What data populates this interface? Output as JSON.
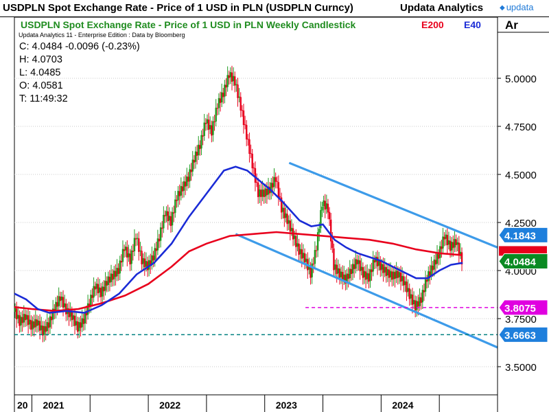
{
  "header": {
    "title": "USDPLN Spot Exchange Rate - Price of 1 USD in PLN (USDPLN Curncy)",
    "brand": "Updata Analytics",
    "logo_text": "updata",
    "logo_icon": "updata-logo-icon",
    "corner_label": "Ar"
  },
  "chart_data": {
    "type": "candlestick",
    "title": "USDPLN Spot Exchange Rate - Price of 1 USD in PLN Weekly Candlestick",
    "indicators": [
      {
        "name": "E200",
        "color": "#e8001c"
      },
      {
        "name": "E40",
        "color": "#1a2bd6"
      }
    ],
    "source_note": "Updata Analytics 11 - Enterprise Edition : Data by Bloomberg",
    "readout": {
      "close": "C: 4.0484  -0.0096 (-0.23%)",
      "high": "H: 4.0703",
      "low": "L: 4.0485",
      "open": "O: 4.0581",
      "time": "T: 11:49:32"
    },
    "x_axis_labels": [
      "20",
      "2021",
      "2022",
      "2023",
      "2024"
    ],
    "y_ticks": [
      "5.0000",
      "4.7500",
      "4.5000",
      "4.2500",
      "4.0000",
      "3.7500",
      "3.5000"
    ],
    "y_tick_values": [
      5.0,
      4.75,
      4.5,
      4.25,
      4.0,
      3.75,
      3.5
    ],
    "ylim": [
      3.42,
      5.17
    ],
    "x_range": [
      2020.85,
      2025.0
    ],
    "close_series": [
      [
        2020.85,
        3.8
      ],
      [
        2020.9,
        3.73
      ],
      [
        2020.95,
        3.76
      ],
      [
        2021.0,
        3.71
      ],
      [
        2021.05,
        3.73
      ],
      [
        2021.1,
        3.68
      ],
      [
        2021.15,
        3.72
      ],
      [
        2021.2,
        3.8
      ],
      [
        2021.25,
        3.86
      ],
      [
        2021.3,
        3.79
      ],
      [
        2021.35,
        3.76
      ],
      [
        2021.4,
        3.7
      ],
      [
        2021.45,
        3.74
      ],
      [
        2021.5,
        3.83
      ],
      [
        2021.55,
        3.92
      ],
      [
        2021.6,
        3.88
      ],
      [
        2021.65,
        3.94
      ],
      [
        2021.7,
        3.97
      ],
      [
        2021.75,
        4.0
      ],
      [
        2021.8,
        4.12
      ],
      [
        2021.85,
        4.05
      ],
      [
        2021.9,
        4.18
      ],
      [
        2021.95,
        4.05
      ],
      [
        2022.0,
        4.02
      ],
      [
        2022.05,
        4.07
      ],
      [
        2022.1,
        4.17
      ],
      [
        2022.15,
        4.3
      ],
      [
        2022.2,
        4.25
      ],
      [
        2022.25,
        4.38
      ],
      [
        2022.3,
        4.43
      ],
      [
        2022.35,
        4.48
      ],
      [
        2022.4,
        4.58
      ],
      [
        2022.45,
        4.65
      ],
      [
        2022.5,
        4.78
      ],
      [
        2022.55,
        4.72
      ],
      [
        2022.6,
        4.86
      ],
      [
        2022.65,
        4.92
      ],
      [
        2022.7,
        5.02
      ],
      [
        2022.75,
        4.98
      ],
      [
        2022.8,
        4.85
      ],
      [
        2022.85,
        4.7
      ],
      [
        2022.9,
        4.55
      ],
      [
        2022.95,
        4.4
      ],
      [
        2023.0,
        4.4
      ],
      [
        2023.05,
        4.42
      ],
      [
        2023.1,
        4.48
      ],
      [
        2023.15,
        4.32
      ],
      [
        2023.2,
        4.26
      ],
      [
        2023.25,
        4.18
      ],
      [
        2023.3,
        4.1
      ],
      [
        2023.35,
        4.06
      ],
      [
        2023.4,
        3.98
      ],
      [
        2023.45,
        4.12
      ],
      [
        2023.5,
        4.35
      ],
      [
        2023.55,
        4.32
      ],
      [
        2023.6,
        4.02
      ],
      [
        2023.65,
        3.98
      ],
      [
        2023.7,
        3.95
      ],
      [
        2023.75,
        4.0
      ],
      [
        2023.8,
        4.05
      ],
      [
        2023.85,
        3.98
      ],
      [
        2023.9,
        3.96
      ],
      [
        2023.95,
        4.06
      ],
      [
        2024.0,
        4.02
      ],
      [
        2024.05,
        3.99
      ],
      [
        2024.1,
        3.97
      ],
      [
        2024.15,
        3.98
      ],
      [
        2024.2,
        3.94
      ],
      [
        2024.25,
        3.87
      ],
      [
        2024.3,
        3.81
      ],
      [
        2024.35,
        3.85
      ],
      [
        2024.4,
        3.96
      ],
      [
        2024.45,
        4.02
      ],
      [
        2024.5,
        4.08
      ],
      [
        2024.55,
        4.18
      ],
      [
        2024.6,
        4.12
      ],
      [
        2024.65,
        4.15
      ],
      [
        2024.7,
        4.05
      ]
    ],
    "ema200_series": [
      [
        2020.85,
        3.81
      ],
      [
        2021.0,
        3.8
      ],
      [
        2021.2,
        3.79
      ],
      [
        2021.4,
        3.8
      ],
      [
        2021.6,
        3.83
      ],
      [
        2021.8,
        3.87
      ],
      [
        2022.0,
        3.93
      ],
      [
        2022.2,
        4.02
      ],
      [
        2022.35,
        4.1
      ],
      [
        2022.5,
        4.14
      ],
      [
        2022.7,
        4.18
      ],
      [
        2022.9,
        4.19
      ],
      [
        2023.1,
        4.2
      ],
      [
        2023.3,
        4.19
      ],
      [
        2023.5,
        4.18
      ],
      [
        2023.7,
        4.17
      ],
      [
        2023.9,
        4.16
      ],
      [
        2024.1,
        4.14
      ],
      [
        2024.3,
        4.11
      ],
      [
        2024.5,
        4.09
      ],
      [
        2024.7,
        4.08
      ]
    ],
    "ema40_series": [
      [
        2020.85,
        3.88
      ],
      [
        2020.95,
        3.85
      ],
      [
        2021.05,
        3.8
      ],
      [
        2021.15,
        3.78
      ],
      [
        2021.3,
        3.79
      ],
      [
        2021.45,
        3.78
      ],
      [
        2021.6,
        3.82
      ],
      [
        2021.75,
        3.88
      ],
      [
        2021.9,
        3.98
      ],
      [
        2022.05,
        4.04
      ],
      [
        2022.2,
        4.14
      ],
      [
        2022.35,
        4.28
      ],
      [
        2022.5,
        4.4
      ],
      [
        2022.65,
        4.52
      ],
      [
        2022.75,
        4.54
      ],
      [
        2022.85,
        4.52
      ],
      [
        2022.95,
        4.47
      ],
      [
        2023.05,
        4.42
      ],
      [
        2023.15,
        4.36
      ],
      [
        2023.3,
        4.26
      ],
      [
        2023.4,
        4.23
      ],
      [
        2023.5,
        4.24
      ],
      [
        2023.6,
        4.16
      ],
      [
        2023.7,
        4.12
      ],
      [
        2023.8,
        4.09
      ],
      [
        2023.9,
        4.07
      ],
      [
        2024.0,
        4.05
      ],
      [
        2024.1,
        4.02
      ],
      [
        2024.2,
        3.99
      ],
      [
        2024.3,
        3.96
      ],
      [
        2024.4,
        3.96
      ],
      [
        2024.5,
        4.0
      ],
      [
        2024.6,
        4.03
      ],
      [
        2024.7,
        4.04
      ]
    ],
    "channel_lines": [
      {
        "name": "upper-channel",
        "from": [
          2023.21,
          4.56
        ],
        "to": [
          2025.0,
          4.12
        ],
        "color": "#3d9be9"
      },
      {
        "name": "lower-channel",
        "from": [
          2022.75,
          4.19
        ],
        "to": [
          2025.0,
          3.6
        ],
        "color": "#3d9be9"
      }
    ],
    "horizontal_levels": [
      {
        "name": "support-level-1",
        "value": 3.8075,
        "from_x": 2023.35,
        "color": "#e000e0"
      },
      {
        "name": "support-level-2",
        "value": 3.6663,
        "from_x": 2020.85,
        "color": "#008080"
      }
    ],
    "value_tags": [
      {
        "name": "tag-upper-channel",
        "label": "4.1843",
        "value": 4.1843,
        "color": "#1e7fdc"
      },
      {
        "name": "tag-ema200",
        "label": "4.0484",
        "value": 4.0484,
        "color": "#0a8a22",
        "underlay": "#e8001c"
      },
      {
        "name": "tag-support-1",
        "label": "3.8075",
        "value": 3.8075,
        "color": "#e000e0"
      },
      {
        "name": "tag-support-2",
        "label": "3.6663",
        "value": 3.6663,
        "color": "#1e7fdc"
      }
    ],
    "grid": true
  }
}
